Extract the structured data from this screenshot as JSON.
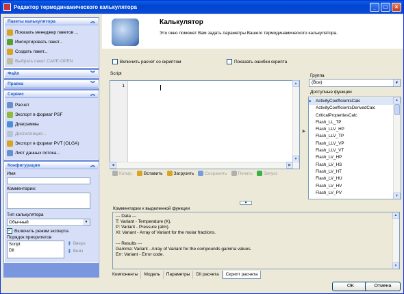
{
  "window": {
    "title": "Редактор термодинамического калькулятора"
  },
  "titlebar_buttons": {
    "minimize": "_",
    "maximize": "□",
    "close": "×"
  },
  "sidebar": {
    "packages": {
      "title": "Пакеты калькулятора",
      "items": [
        {
          "label": "Показать менеджер пакетов ...",
          "icon": "package-manager-icon",
          "enabled": true
        },
        {
          "label": "Импортировать пакет...",
          "icon": "import-icon",
          "enabled": true
        },
        {
          "label": "Создать пакет...",
          "icon": "create-package-icon",
          "enabled": true
        },
        {
          "label": "Выбрать пакет CAPE-OPEN",
          "icon": "cape-open-icon",
          "enabled": false
        }
      ]
    },
    "file": {
      "title": "Файл"
    },
    "edit": {
      "title": "Правка"
    },
    "service": {
      "title": "Сервис",
      "items": [
        {
          "label": "Расчет",
          "icon": "calculate-icon",
          "enabled": true
        },
        {
          "label": "Экспорт в формат PSF",
          "icon": "export-psf-icon",
          "enabled": true
        },
        {
          "label": "Диаграммы",
          "icon": "diagram-icon",
          "enabled": true
        },
        {
          "label": "Дистилляция...",
          "icon": "distillation-icon",
          "enabled": false
        },
        {
          "label": "Экспорт в формат PVT (OLGA)",
          "icon": "export-pvt-icon",
          "enabled": true
        },
        {
          "label": "Лист данных потока...",
          "icon": "data-sheet-icon",
          "enabled": true
        }
      ]
    },
    "config": {
      "title": "Конфигурация",
      "name_label": "Имя",
      "name_value": "",
      "comments_label": "Комментарии:",
      "comments_value": "",
      "type_label": "Тип калькулятора",
      "type_value": "Обычный",
      "expert_label": "Включить режим эксперта",
      "priority_label": "Порядок приоритетов",
      "priority_items": [
        "Script",
        "Dll"
      ],
      "up_label": "Вверх",
      "down_label": "Вниз"
    }
  },
  "header": {
    "title": "Калькулятор",
    "description": "Это окно поможет Вам задать параметры Вашего термодинамического калькулятора."
  },
  "options": {
    "enable_script": "Включить расчет со скриптом",
    "show_errors": "Показать ошибки скрипта"
  },
  "script": {
    "label": "Script",
    "line_number": "1",
    "toolbar": [
      {
        "label": "Копир.",
        "icon": "copy-icon",
        "enabled": false
      },
      {
        "label": "Вставить",
        "icon": "paste-icon",
        "enabled": true
      },
      {
        "label": "Загрузить",
        "icon": "load-icon",
        "enabled": true
      },
      {
        "label": "Сохранить",
        "icon": "save-icon",
        "enabled": false
      },
      {
        "label": "Печать",
        "icon": "print-icon",
        "enabled": false
      },
      {
        "label": "Запуск",
        "icon": "run-icon",
        "enabled": false
      }
    ]
  },
  "functions": {
    "group_label": "Группа",
    "group_value": "(Все)",
    "available_label": "Доступные функции",
    "items": [
      "ActivityCoefficientsCalc",
      "ActivityCoefficientsDerivedCalc",
      "CriticalPropertiesCalc",
      "Flash_LL_TP",
      "Flash_LLV_HP",
      "Flash_LLV_TP",
      "Flash_LLV_VP",
      "Flash_LLV_VT",
      "Flash_LV_HP",
      "Flash_LV_HS",
      "Flash_LV_HT",
      "Flash_LV_HU",
      "Flash_LV_HV",
      "Flash_LV_PV"
    ],
    "selected_index": 0
  },
  "comment": {
    "label": "Комментарии к выделенной функции",
    "lines": [
      "--- Data ---",
      "T: Variant - Temperature (K).",
      "P: Variant - Pressure (atm).",
      "Xl: Variant - Array of Variant for the molar fractions.",
      "",
      "--- Results ---",
      "Gamma: Variant - Array of Variant for the compounds gamma values.",
      "Err: Variant - Error code."
    ]
  },
  "tabs": [
    {
      "label": "Компоненты",
      "active": false
    },
    {
      "label": "Модель",
      "active": false
    },
    {
      "label": "Параметры",
      "active": false
    },
    {
      "label": "Dll расчета",
      "active": false
    },
    {
      "label": "Скрипт расчета",
      "active": true
    }
  ],
  "buttons": {
    "ok": "OK",
    "cancel": "Отмена"
  },
  "colors": {
    "titlebar": "#0a5fe5",
    "sidebar_bg": "#7a96df",
    "panel_head_text": "#215dc6",
    "window_bg": "#ece9d8"
  }
}
